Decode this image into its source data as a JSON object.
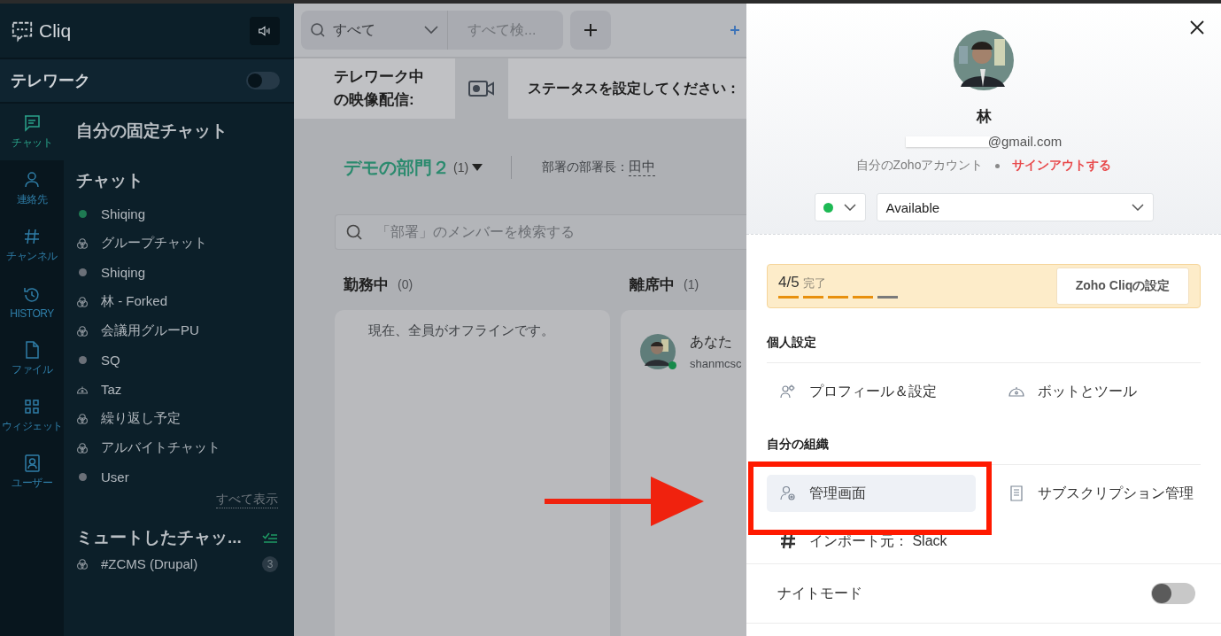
{
  "app": {
    "name": "Cliq"
  },
  "telework": {
    "label": "テレワーク",
    "on": false
  },
  "rail": [
    {
      "label": "チャット",
      "selected": true
    },
    {
      "label": "連絡先",
      "selected": false
    },
    {
      "label": "チャンネル",
      "selected": false
    },
    {
      "label": "HISTORY",
      "selected": false
    },
    {
      "label": "ファイル",
      "selected": false
    },
    {
      "label": "ウィジェット",
      "selected": false
    },
    {
      "label": "ユーザー",
      "selected": false
    }
  ],
  "pinned_title": "自分の固定チャット",
  "chats_title": "チャット",
  "chats": [
    {
      "name": "Shiqing",
      "kind": "dot",
      "color": "#1e7a52"
    },
    {
      "name": "グループチャット",
      "kind": "group"
    },
    {
      "name": "Shiqing",
      "kind": "dot",
      "color": "#6b7078"
    },
    {
      "name": "林 - Forked",
      "kind": "group"
    },
    {
      "name": "会議用グルーPU",
      "kind": "group"
    },
    {
      "name": "SQ",
      "kind": "dot",
      "color": "#6b7078"
    },
    {
      "name": "Taz",
      "kind": "bot"
    },
    {
      "name": "繰り返し予定",
      "kind": "group"
    },
    {
      "name": "アルバイトチャット",
      "kind": "group"
    },
    {
      "name": "User",
      "kind": "dot",
      "color": "#6b7078"
    }
  ],
  "show_all": "すべて表示",
  "muted_title": "ミュートしたチャッ...",
  "muted": [
    {
      "name": "#ZCMS (Drupal)",
      "kind": "group",
      "count": "3"
    }
  ],
  "topbar": {
    "scope": "すべて",
    "search_placeholder": "すべて検..."
  },
  "video_bar": {
    "label": "テレワーク中の映像配信:",
    "status_prompt": "ステータスを設定してください："
  },
  "department": {
    "name": "デモの部門２",
    "count": "(1)",
    "head_label": "部署の部署長：",
    "head_name": "田中"
  },
  "member_search": {
    "placeholder": "「部署」のメンバーを検索する"
  },
  "columns": [
    {
      "title": "勤務中",
      "count": "(0)",
      "empty_text": "現在、全員がオフラインです。"
    },
    {
      "title": "離席中",
      "count": "(1)",
      "member": {
        "name": "あなた",
        "id": "shanmcsc"
      }
    }
  ],
  "profile": {
    "name": "林",
    "email": "@gmail.com",
    "account_link": "自分のZohoアカウント",
    "signout": "サインアウトする",
    "status_text": "Available"
  },
  "setup": {
    "progress": "4/5",
    "label": "完了",
    "level": 0.8,
    "button": "Zoho Cliqの設定"
  },
  "sections": [
    {
      "title": "個人設定",
      "items": [
        {
          "label": "プロフィール＆設定",
          "selected": false
        },
        {
          "label": "ボットとツール",
          "selected": false
        }
      ]
    },
    {
      "title": "自分の組織",
      "items": [
        {
          "label": "管理画面",
          "selected": true
        },
        {
          "label": "サブスクリプション管理",
          "selected": false
        },
        {
          "label": "インポート元： Slack",
          "selected": false
        }
      ]
    }
  ],
  "night_mode": {
    "label": "ナイトモード",
    "on": false
  }
}
